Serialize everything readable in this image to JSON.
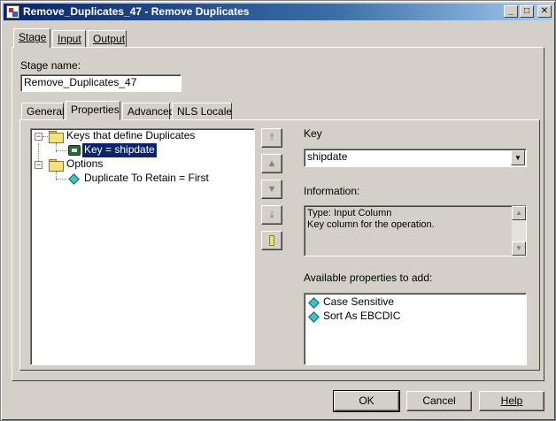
{
  "window": {
    "title": "Remove_Duplicates_47 - Remove Duplicates",
    "minimize": "_",
    "maximize": "□",
    "close": "✕"
  },
  "top_tabs": [
    {
      "label": "Stage",
      "active": true
    },
    {
      "label": "Input",
      "active": false
    },
    {
      "label": "Output",
      "active": false
    }
  ],
  "stage_name": {
    "label": "Stage name:",
    "value": "Remove_Duplicates_47"
  },
  "sub_tabs": [
    {
      "label": "General",
      "active": false
    },
    {
      "label": "Properties",
      "active": true
    },
    {
      "label": "Advanced",
      "active": false
    },
    {
      "label": "NLS Locale",
      "active": false
    }
  ],
  "tree": {
    "groups": [
      {
        "label": "Keys that define Duplicates",
        "expander": "−",
        "children": [
          {
            "label": "Key = shipdate",
            "selected": true,
            "icon": "key-column-icon"
          }
        ]
      },
      {
        "label": "Options",
        "expander": "−",
        "children": [
          {
            "label": "Duplicate To Retain = First",
            "selected": false,
            "icon": "property-diamond-icon"
          }
        ]
      }
    ]
  },
  "side_buttons": [
    "move-to-top",
    "move-up",
    "move-down",
    "move-to-bottom",
    "remove"
  ],
  "key": {
    "label": "Key",
    "value": "shipdate"
  },
  "information": {
    "label": "Information:",
    "line1": "Type: Input Column",
    "line2": "Key column for the operation."
  },
  "available": {
    "label": "Available properties to add:",
    "items": [
      "Case Sensitive",
      "Sort As EBCDIC"
    ]
  },
  "buttons": {
    "ok": "OK",
    "cancel": "Cancel",
    "help": "Help"
  },
  "colors": {
    "titlebar_start": "#0a246a",
    "selection": "#0a246a",
    "face": "#d4d0c8"
  }
}
